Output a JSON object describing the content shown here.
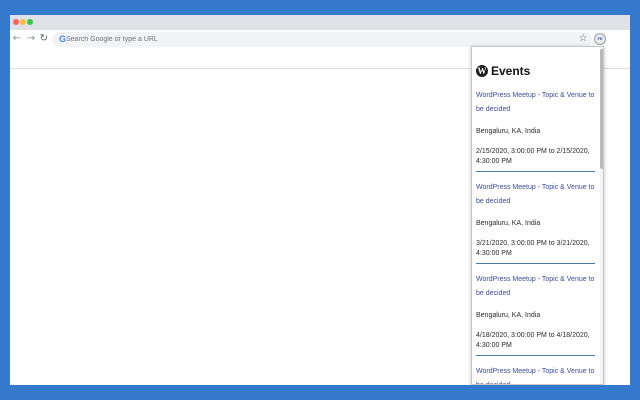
{
  "browser": {
    "omnibox_placeholder": "Search Google or type a URL",
    "google_icon": "google-icon",
    "extension_badge": "FE"
  },
  "popup": {
    "title": "Events",
    "logo": "wordpress-logo",
    "events": [
      {
        "title": "WordPress Meetup - Topic & Venue to be decided",
        "location": "Bengaluru, KA, India",
        "time": "2/15/2020, 3:00:00 PM to 2/15/2020, 4:30:00 PM"
      },
      {
        "title": "WordPress Meetup - Topic & Venue to be decided",
        "location": "Bengaluru, KA, India",
        "time": "3/21/2020, 3:00:00 PM to 3/21/2020, 4:30:00 PM"
      },
      {
        "title": "WordPress Meetup - Topic & Venue to be decided",
        "location": "Bengaluru, KA, India",
        "time": "4/18/2020, 3:00:00 PM to 4/18/2020, 4:30:00 PM"
      },
      {
        "title": "WordPress Meetup - Topic & Venue to be decided",
        "location": "",
        "time": ""
      }
    ]
  },
  "colors": {
    "background": "#3579cc",
    "event_link": "#3c4b9c",
    "divider": "#4d7aa6"
  }
}
